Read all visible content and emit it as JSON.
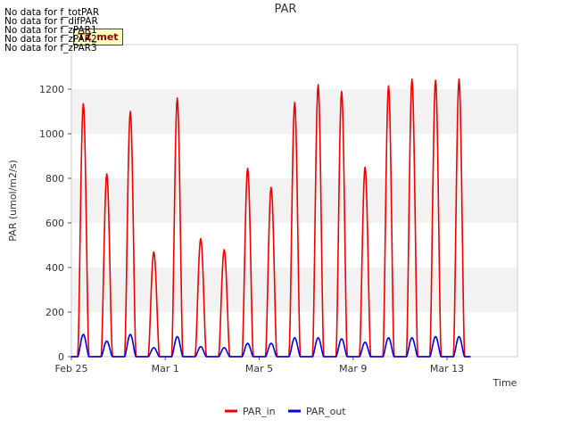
{
  "chart_data": {
    "type": "line",
    "title": "PAR",
    "xlabel": "Time",
    "ylabel": "PAR (umol/m2/s)",
    "ylim": [
      0,
      1400
    ],
    "yticks": [
      0,
      200,
      400,
      600,
      800,
      1000,
      1200
    ],
    "xlim": [
      "2022-02-25",
      "2022-03-16"
    ],
    "xticks": [
      {
        "date": "2022-02-25",
        "label": "Feb 25"
      },
      {
        "date": "2022-03-01",
        "label": "Mar 1"
      },
      {
        "date": "2022-03-05",
        "label": "Mar 5"
      },
      {
        "date": "2022-03-09",
        "label": "Mar 9"
      },
      {
        "date": "2022-03-13",
        "label": "Mar 13"
      }
    ],
    "grid": "horizontal bands",
    "legend_position": "bottom",
    "series": [
      {
        "name": "PAR_in",
        "color": "#ee0000",
        "daily": [
          {
            "date": "2022-02-25",
            "peak": 1135
          },
          {
            "date": "2022-02-26",
            "peak": 820
          },
          {
            "date": "2022-02-27",
            "peak": 1100
          },
          {
            "date": "2022-02-28",
            "peak": 470
          },
          {
            "date": "2022-03-01",
            "peak": 1160
          },
          {
            "date": "2022-03-02",
            "peak": 530
          },
          {
            "date": "2022-03-03",
            "peak": 480
          },
          {
            "date": "2022-03-04",
            "peak": 845
          },
          {
            "date": "2022-03-05",
            "peak": 760
          },
          {
            "date": "2022-03-06",
            "peak": 1140
          },
          {
            "date": "2022-03-07",
            "peak": 1220
          },
          {
            "date": "2022-03-08",
            "peak": 1190
          },
          {
            "date": "2022-03-09",
            "peak": 850
          },
          {
            "date": "2022-03-10",
            "peak": 1215
          },
          {
            "date": "2022-03-11",
            "peak": 1245
          },
          {
            "date": "2022-03-12",
            "peak": 1240
          },
          {
            "date": "2022-03-13",
            "peak": 1245
          }
        ]
      },
      {
        "name": "PAR_out",
        "color": "#0000dd",
        "daily": [
          {
            "date": "2022-02-25",
            "peak": 100
          },
          {
            "date": "2022-02-26",
            "peak": 70
          },
          {
            "date": "2022-02-27",
            "peak": 100
          },
          {
            "date": "2022-02-28",
            "peak": 40
          },
          {
            "date": "2022-03-01",
            "peak": 90
          },
          {
            "date": "2022-03-02",
            "peak": 45
          },
          {
            "date": "2022-03-03",
            "peak": 40
          },
          {
            "date": "2022-03-04",
            "peak": 60
          },
          {
            "date": "2022-03-05",
            "peak": 60
          },
          {
            "date": "2022-03-06",
            "peak": 85
          },
          {
            "date": "2022-03-07",
            "peak": 85
          },
          {
            "date": "2022-03-08",
            "peak": 80
          },
          {
            "date": "2022-03-09",
            "peak": 65
          },
          {
            "date": "2022-03-10",
            "peak": 85
          },
          {
            "date": "2022-03-11",
            "peak": 85
          },
          {
            "date": "2022-03-12",
            "peak": 90
          },
          {
            "date": "2022-03-13",
            "peak": 90
          }
        ]
      }
    ]
  },
  "messages": [
    "No data for f_totPAR",
    "No data for f_difPAR",
    "No data for f_zPAR1",
    "No data for f_zPAR2",
    "No data for f_zPAR3"
  ],
  "badge": "TZ_met"
}
